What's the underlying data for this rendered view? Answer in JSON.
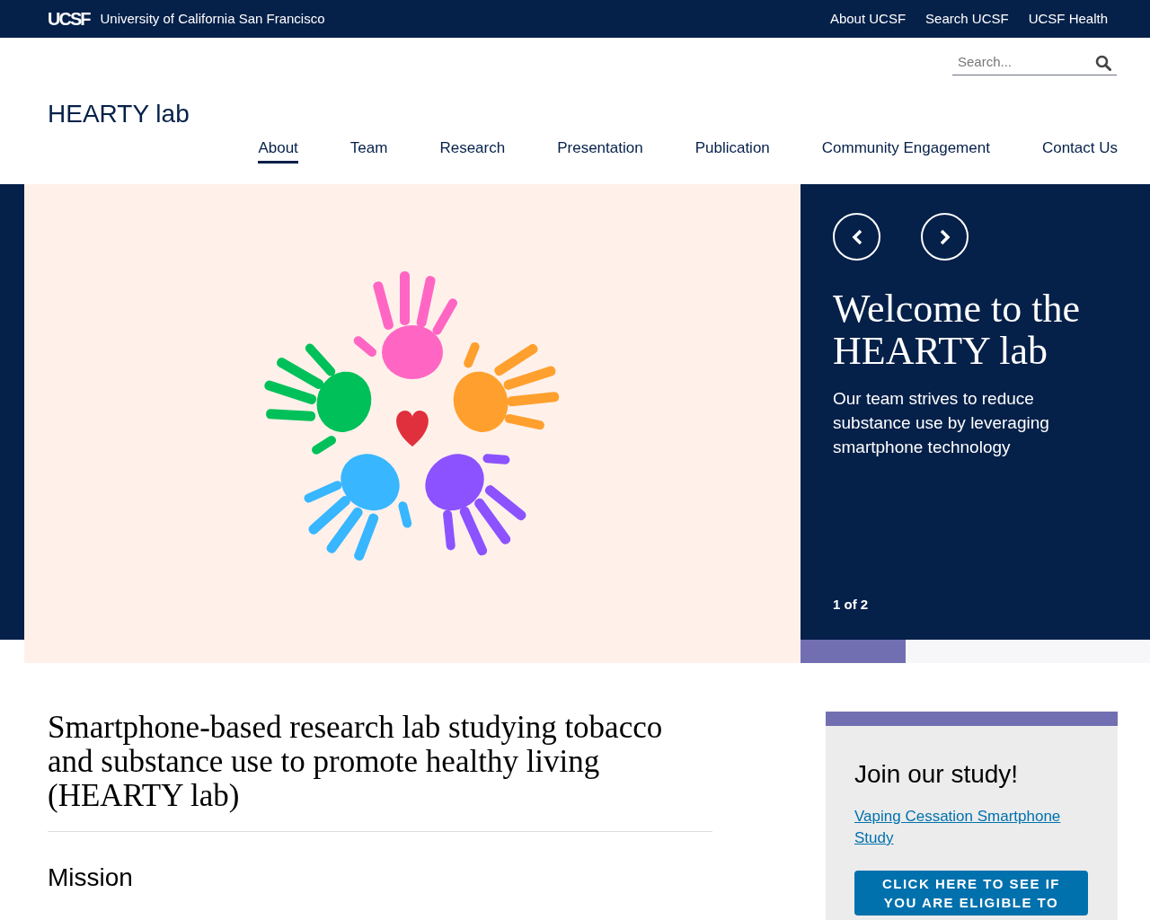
{
  "top_bar": {
    "logo": "UCSF",
    "university": "University of California San Francisco",
    "links": [
      "About UCSF",
      "Search UCSF",
      "UCSF Health"
    ]
  },
  "search": {
    "placeholder": "Search..."
  },
  "site_title": "HEARTY lab",
  "nav": [
    {
      "label": "About",
      "selected": true
    },
    {
      "label": "Team",
      "selected": false
    },
    {
      "label": "Research",
      "selected": false
    },
    {
      "label": "Presentation",
      "selected": false
    },
    {
      "label": "Publication",
      "selected": false
    },
    {
      "label": "Community Engagement",
      "selected": false
    },
    {
      "label": "Contact Us",
      "selected": false
    }
  ],
  "carousel": {
    "title": "Welcome to the HEARTY lab",
    "text": "Our team strives to reduce substance use by leveraging smartphone technology",
    "counter": "1 of 2",
    "level": 0.3
  },
  "main": {
    "heading": "Smartphone-based research lab studying tobacco and substance use to promote healthy living (HEARTY lab)",
    "subheading": "Mission"
  },
  "sidebar_card": {
    "title": "Join our study!",
    "link": "Vaping Cessation Smartphone Study",
    "button": "CLICK HERE TO SEE IF YOU ARE ELIGIBLE TO"
  }
}
